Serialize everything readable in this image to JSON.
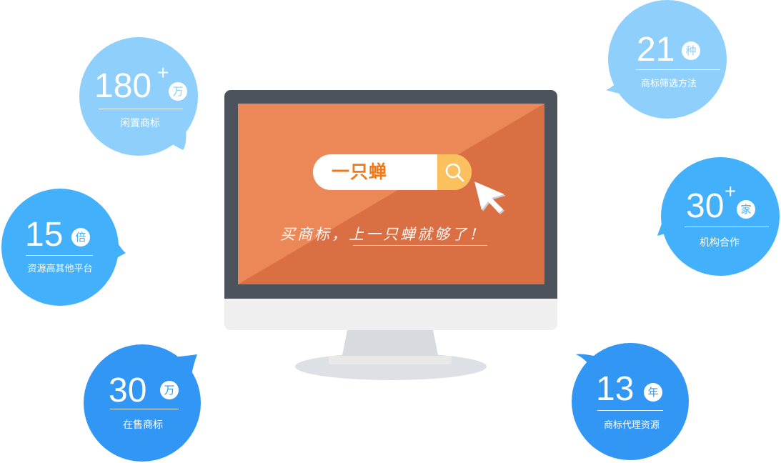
{
  "search": {
    "text": "一只蝉"
  },
  "slogan": "买商标，上一只蝉就够了！",
  "colors": {
    "screen_light": "#ec8858",
    "screen_dark": "#d96f43",
    "search_accent": "#f07a1a",
    "bubble_light": "#8ed0fb",
    "bubble_mid": "#42b0fa",
    "bubble_dark": "#3296f5"
  },
  "stats": [
    {
      "number": "180",
      "plus": "+",
      "unit": "万",
      "label": "闲置商标",
      "icon": "speech-bubble"
    },
    {
      "number": "15",
      "plus": "",
      "unit": "倍",
      "label": "资源高其他平台",
      "icon": "speech-bubble"
    },
    {
      "number": "30",
      "plus": "",
      "unit": "万",
      "label": "在售商标",
      "icon": "speech-bubble"
    },
    {
      "number": "21",
      "plus": "",
      "unit": "种",
      "label": "商标筛选方法",
      "icon": "speech-bubble"
    },
    {
      "number": "30",
      "plus": "+",
      "unit": "家",
      "label": "机构合作",
      "icon": "speech-bubble"
    },
    {
      "number": "13",
      "plus": "",
      "unit": "年",
      "label": "商标代理资源",
      "icon": "speech-bubble"
    }
  ]
}
